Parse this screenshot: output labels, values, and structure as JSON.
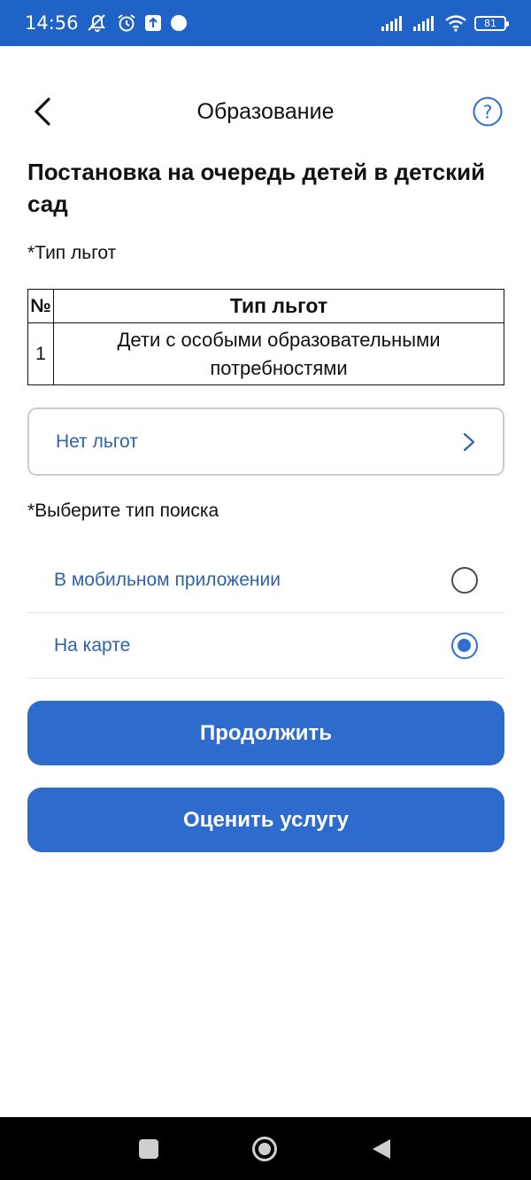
{
  "status_bar": {
    "time": "14:56",
    "battery": "81",
    "icons": [
      "muted-notification-icon",
      "alarm-icon",
      "upload-icon",
      "dot-icon",
      "signal-icon",
      "signal-icon",
      "wifi-icon",
      "battery-icon"
    ]
  },
  "header": {
    "title": "Образование",
    "back_icon": "chevron-left-icon",
    "help_icon": "help-circle-icon"
  },
  "page": {
    "heading": "Постановка на очередь детей в детский сад",
    "benefit_label": "*Тип льгот",
    "table": {
      "headers": [
        "№",
        "Тип льгот"
      ],
      "rows": [
        {
          "num": "1",
          "type": "Дети с особыми образовательными потребностями"
        }
      ]
    },
    "benefit_select": {
      "value": "Нет льгот"
    },
    "search_label": "*Выберите тип поиска",
    "search_options": [
      {
        "label": "В мобильном приложении",
        "selected": false
      },
      {
        "label": "На карте",
        "selected": true
      }
    ],
    "continue_button": "Продолжить",
    "rate_button": "Оценить услугу"
  },
  "colors": {
    "status_bar": "#1f63c6",
    "accent": "#2d6bcc",
    "link_text": "#2d63a8"
  },
  "nav_bar": {
    "icons": [
      "recents-icon",
      "home-icon",
      "back-icon"
    ]
  }
}
